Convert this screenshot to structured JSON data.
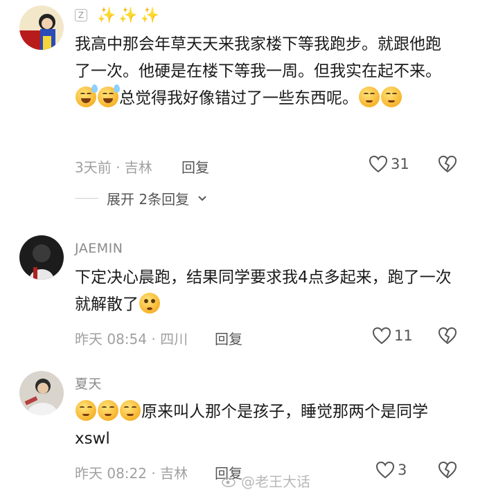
{
  "comments": [
    {
      "username": "Z",
      "sparkles": "✨✨✨",
      "text_part1": "我高中那会年草天天来我家楼下等我跑步。就跟他跑了一次。他硬是在楼下等我一周。但我实在起不来。",
      "text_part2": "总觉得我好像错过了一些东西呢。",
      "meta": "3天前 · 吉林",
      "reply_label": "回复",
      "likes": "31",
      "expand_label": "展开 2条回复",
      "emoji_a": "grinning-sweat-emoji",
      "emoji_b": "relieved-emoji"
    },
    {
      "username": "JAEMIN",
      "text_part1": "下定决心晨跑，结果同学要求我4点多起来，跑了一次就解散了",
      "meta": "昨天 08:54 · 四川",
      "reply_label": "回复",
      "likes": "11",
      "emoji_a": "flushed-emoji"
    },
    {
      "username": "夏天",
      "text_part1": "原来叫人那个是孩子，睡觉那两个是同学xswl",
      "meta": "昨天 08:22 · 吉林",
      "reply_label": "回复",
      "likes": "3",
      "emoji_a": "dizzy-face-emoji"
    }
  ],
  "watermark": "@老王大话",
  "colors": {
    "meta_gray": "#a0a0a0",
    "text": "#1a1a1a",
    "emoji_yellow": "#f7b42c"
  }
}
